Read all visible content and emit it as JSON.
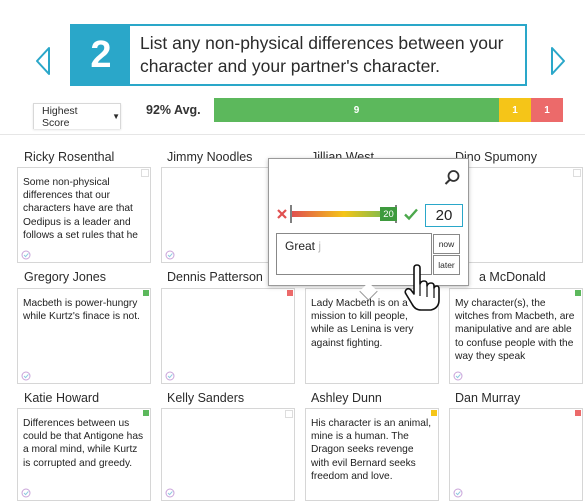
{
  "prompt": {
    "number": "2",
    "text": "List any non-physical differences between your character and your partner's character."
  },
  "toolbar": {
    "sort_label": "Highest Score",
    "avg_label": "92% Avg."
  },
  "score_bar": [
    {
      "label": "9",
      "color": "#5cb85c",
      "fraction": 0.818
    },
    {
      "label": "1",
      "color": "#f5c518",
      "fraction": 0.091
    },
    {
      "label": "1",
      "color": "#ec6a6a",
      "fraction": 0.091
    }
  ],
  "students": [
    {
      "name": "Ricky Rosenthal",
      "answer": "Some non-physical differences that our characters have are that Oedipus is a leader and follows a set rules that he",
      "flag": "#ffffff"
    },
    {
      "name": "Jimmy Noodles",
      "answer": "",
      "flag": "#ffffff"
    },
    {
      "name": "Jillian West",
      "answer": "",
      "flag": ""
    },
    {
      "name": "Dino Spumony",
      "answer": "",
      "flag": "#ffffff"
    },
    {
      "name": "Gregory Jones",
      "answer": "Macbeth is power-hungry while Kurtz's finace is not.",
      "flag": "#5cb85c"
    },
    {
      "name": "Dennis Patterson",
      "answer": "",
      "flag": "#ec6a6a"
    },
    {
      "name": "",
      "answer": "Lady Macbeth is on a mission to kill people, while as Lenina is very against fighting.",
      "flag": ""
    },
    {
      "name": "a McDonald",
      "answer": "My character(s), the witches from Macbeth, are manipulative and are able to confuse people with the way they speak",
      "flag": "#5cb85c"
    },
    {
      "name": "Katie Howard",
      "answer": "Differences between us could be that Antigone has a moral mind, while Kurtz is corrupted and greedy.",
      "flag": "#5cb85c"
    },
    {
      "name": "Kelly Sanders",
      "answer": "",
      "flag": "#ffffff"
    },
    {
      "name": "Ashley Dunn",
      "answer": "His character is an animal, mine is a human. The Dragon seeks revenge with evil Bernard seeks freedom and love.",
      "flag": "#f5c518"
    },
    {
      "name": "Dan Murray",
      "answer": "",
      "flag": "#ec6a6a"
    }
  ],
  "grader": {
    "slider_value": "20",
    "score_value": "20",
    "comment": "Great",
    "cursor": "j",
    "now_label": "now",
    "later_label": "later",
    "score_fraction": 1.0
  },
  "icons": {
    "prev": "chevron-left-icon",
    "next": "chevron-right-icon",
    "search": "search-icon",
    "reject": "x-icon",
    "accept": "check-icon",
    "pointer": "hand-pointer-icon"
  },
  "colors": {
    "accent": "#2aa7c9",
    "green": "#5cb85c",
    "yellow": "#f5c518",
    "red": "#ec6a6a"
  }
}
